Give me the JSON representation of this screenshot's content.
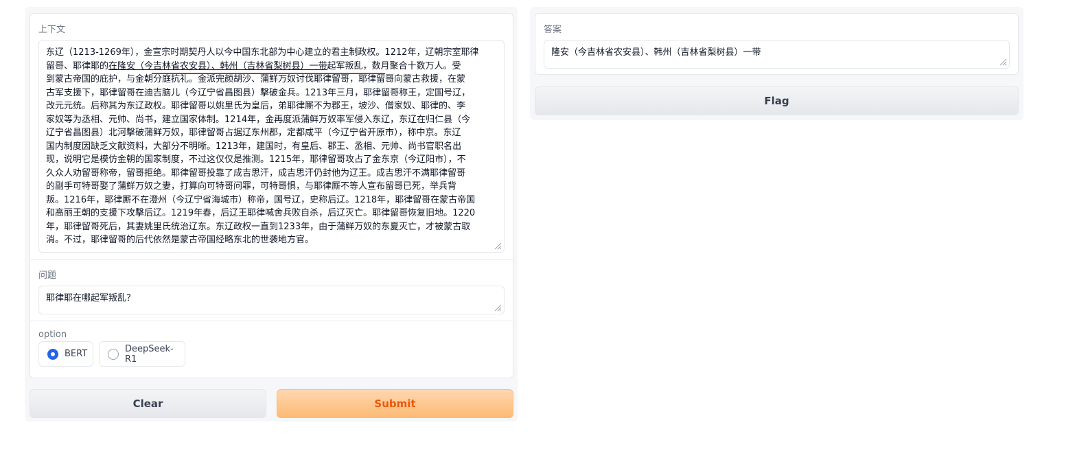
{
  "context": {
    "label": "上下文",
    "lines": [
      "东辽（1213-1269年），金宣宗时期契丹人以今中国东北部为中心建立的君主制政权。1212年，辽朝宗室耶律",
      "留哥、耶律耶的",
      "在隆安（今吉林省农安县）、韩州（吉林省梨树县）一带",
      "起军叛乱，数月聚合十数万人。受",
      "到蒙古帝国的庇护，与金朝分庭抗礼。金派完颜胡沙、蒲鲜万奴讨伐耶律留哥，耶律留哥向蒙古救援，在蒙",
      "古军支援下，耶律留哥在迪吉脑儿（今辽宁省昌图县）擊破金兵。1213年三月，耶律留哥称王，定国号辽，",
      "改元元统。后称其为东辽政权。耶律留哥以姚里氏为皇后，弟耶律厮不为郡王，坡沙、僧家奴、耶律的、李",
      "家奴等为丞相、元帅、尚书，建立国家体制。1214年，金再度派蒲鲜万奴率军侵入东辽，东辽在归仁县（今",
      "辽宁省昌图县）北河擊破蒲鲜万奴，耶律留哥占据辽东州郡，定都咸平（今辽宁省开原市），称中京。东辽",
      "国内制度因缺乏文献资料，大部分不明晰。1213年，建国时，有皇后、郡王、丞相、元帅、尚书官职名出",
      "现，说明它是模仿金朝的国家制度，不过这仅仅是推测。1215年，耶律留哥攻占了金东京（今辽阳市），不",
      "久众人劝留哥称帝，留哥拒绝。耶律留哥投靠了成吉思汗，成吉思汗仍封他为辽王。成吉思汗不满耶律留哥",
      "的副手可特哥娶了蒲鲜万奴之妻，打算向可特哥问罪，可特哥惧，与耶律厮不等人宣布留哥已死，举兵背",
      "叛。1216年，耶律厮不在澄州（今辽宁省海城市）称帝，国号辽，史称后辽。1218年，耶律留哥在蒙古帝国",
      "和高丽王朝的支援下攻擊后辽。1219年春，后辽王耶律喊舍兵败自杀，后辽灭亡。耶律留哥恢复旧地。1220",
      "年，耶律留哥死后，其妻姚里氏统治辽东。东辽政权一直到1233年，由于蒲鲜万奴的东夏灭亡，才被蒙古取",
      "消。不过，耶律留哥的后代依然是蒙古帝国经略东北的世袭地方官。"
    ]
  },
  "question": {
    "label": "问题",
    "value": "耶律耶在哪起军叛乱？"
  },
  "option": {
    "label": "option",
    "choices": [
      "BERT",
      "DeepSeek-R1"
    ],
    "selected": "BERT"
  },
  "buttons": {
    "clear": "Clear",
    "submit": "Submit",
    "flag": "Flag"
  },
  "answer": {
    "label": "答案",
    "value": "隆安（今吉林省农安县）、韩州（吉林省梨树县）一带"
  },
  "colors": {
    "primary_text": "#ea580c",
    "primary_bg": "#fdba74",
    "radio_selected": "#2563eb",
    "highlight_underline": "#dc2626"
  }
}
